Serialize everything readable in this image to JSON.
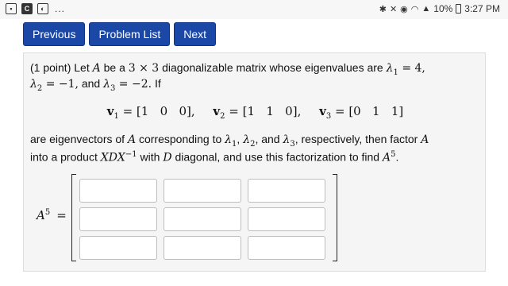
{
  "status_bar": {
    "left_icons": [
      "image-icon",
      "app-icon",
      "gallery-icon"
    ],
    "dots": "...",
    "right_icons": [
      "bluetooth-icon",
      "mute-icon",
      "alarm-icon",
      "wifi-icon",
      "signal-icon"
    ],
    "battery_percent": "10%",
    "time": "3:27 PM"
  },
  "nav": {
    "previous_label": "Previous",
    "problem_list_label": "Problem List",
    "next_label": "Next"
  },
  "problem": {
    "points": "(1 point)",
    "line1": {
      "t1": " Let ",
      "A": "A",
      "t2": " be a ",
      "dim": "3 × 3",
      "t3": " diagonalizable matrix whose eigenvalues are ",
      "l1": "λ",
      "l1_sub": "1",
      "l1_val": " = 4,"
    },
    "line2": {
      "l2": "λ",
      "l2_sub": "2",
      "l2_val": " = −1,",
      "t1": " and ",
      "l3": "λ",
      "l3_sub": "3",
      "l3_val": " = −2.",
      "t2": " If"
    },
    "vectors": [
      {
        "name": "v",
        "sub": "1",
        "value": " = [1   0   0],"
      },
      {
        "name": "v",
        "sub": "2",
        "value": " = [1   1   0],"
      },
      {
        "name": "v",
        "sub": "3",
        "value": " = [0   1   1]"
      }
    ],
    "line3": {
      "t1": "are eigenvectors of ",
      "A": "A",
      "t2": " corresponding to ",
      "lams": "λ",
      "s1": "1",
      "c1": ", ",
      "s2": "2",
      "c2": ", and ",
      "s3": "3",
      "t3": ", respectively, then factor ",
      "A2": "A"
    },
    "line4": {
      "t1": "into a product ",
      "XDX": "XDX",
      "inv": "−1",
      "t2": " with ",
      "D": "D",
      "t3": " diagonal, and use this factorization to find ",
      "A": "A",
      "pow": "5",
      "t4": "."
    },
    "answer_label": "A",
    "answer_pow": "5",
    "answer_eq": "=",
    "matrix_cells": [
      "",
      "",
      "",
      "",
      "",
      "",
      "",
      "",
      ""
    ]
  }
}
